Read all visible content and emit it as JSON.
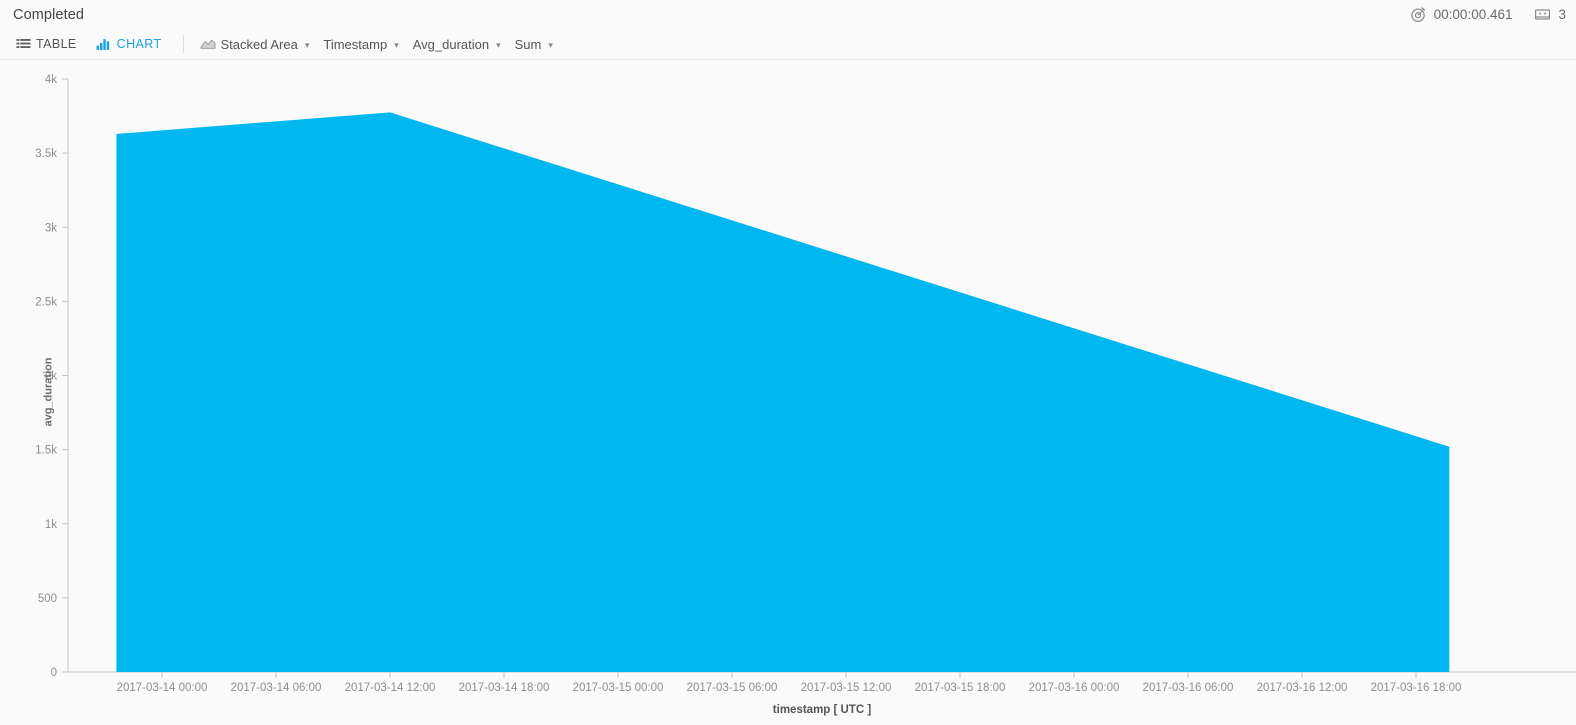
{
  "header": {
    "status": "Completed",
    "stats": [
      {
        "icon": "stopwatch-icon",
        "value": "00:00:00.461"
      },
      {
        "icon": "records-icon",
        "value": "3"
      }
    ]
  },
  "toolbar": {
    "views": [
      {
        "id": "table",
        "label": "TABLE",
        "icon": "table-grid-icon",
        "active": false
      },
      {
        "id": "chart",
        "label": "CHART",
        "icon": "bar-chart-icon",
        "active": true
      }
    ],
    "selectors": [
      {
        "id": "chart-type",
        "label": "Stacked Area",
        "icon": "area-chart-icon",
        "caret": "⌄"
      },
      {
        "id": "x-axis",
        "label": "Timestamp",
        "icon": "",
        "caret": "⌄"
      },
      {
        "id": "y-axis",
        "label": "Avg_duration",
        "icon": "",
        "caret": "⌄"
      },
      {
        "id": "aggregation",
        "label": "Sum",
        "icon": "",
        "caret": "⌄"
      }
    ]
  },
  "colors": {
    "series": "#00b7ef",
    "accent": "#1ba1e2",
    "axis": "#b8b8b8",
    "tick_text": "#8d8d8d",
    "background": "#fafafa"
  },
  "chart_data": {
    "type": "area",
    "title": "",
    "xlabel": "timestamp [ UTC ]",
    "ylabel": "avg_duration",
    "grid": false,
    "legend": null,
    "stacked": true,
    "xlim": [
      "2017-03-13 21:36",
      "2017-03-16 19:45"
    ],
    "ylim": [
      0,
      4000
    ],
    "ytick_labels": [
      "0",
      "500",
      "1k",
      "1.5k",
      "2k",
      "2.5k",
      "3k",
      "3.5k",
      "4k"
    ],
    "ytick_values": [
      0,
      500,
      1000,
      1500,
      2000,
      2500,
      3000,
      3500,
      4000
    ],
    "xtick_labels": [
      "2017-03-14 00:00",
      "2017-03-14 06:00",
      "2017-03-14 12:00",
      "2017-03-14 18:00",
      "2017-03-15 00:00",
      "2017-03-15 06:00",
      "2017-03-15 12:00",
      "2017-03-15 18:00",
      "2017-03-16 00:00",
      "2017-03-16 06:00",
      "2017-03-16 12:00",
      "2017-03-16 18:00"
    ],
    "series": [
      {
        "name": "avg_duration",
        "color": "#00b7ef",
        "points": [
          {
            "x": "2017-03-13 21:36",
            "y": 3630
          },
          {
            "x": "2017-03-14 12:00",
            "y": 3775
          },
          {
            "x": "2017-03-16 19:45",
            "y": 1520
          }
        ]
      }
    ]
  }
}
